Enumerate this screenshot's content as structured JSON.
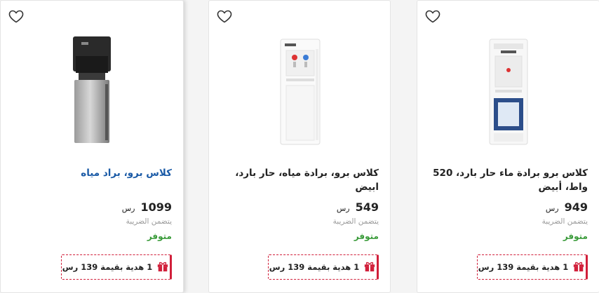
{
  "products": [
    {
      "title": "كلاس برو، براد مياه",
      "price": "1099",
      "currency": "رس",
      "tax_note": "يتضمن الضريبة",
      "stock": "متوفر",
      "gift": "1 هدية بقيمة 139 رس",
      "image_icon": "water-dispenser-black-steel"
    },
    {
      "title": "كلاس برو، برادة مياه، حار بارد، ابيض",
      "price": "549",
      "currency": "رس",
      "tax_note": "يتضمن الضريبة",
      "stock": "متوفر",
      "gift": "1 هدية بقيمة 139 رس",
      "image_icon": "water-dispenser-white"
    },
    {
      "title": "كلاس برو برادة ماء حار بارد، 520 واط، أبيض",
      "price": "949",
      "currency": "رس",
      "tax_note": "يتضمن الضريبة",
      "stock": "متوفر",
      "gift": "1 هدية بقيمة 139 رس",
      "image_icon": "water-dispenser-white-bottom-load"
    }
  ],
  "colors": {
    "accent": "#d11f3a",
    "stock_green": "#3a9b3a",
    "link_blue": "#1a5aa6"
  }
}
